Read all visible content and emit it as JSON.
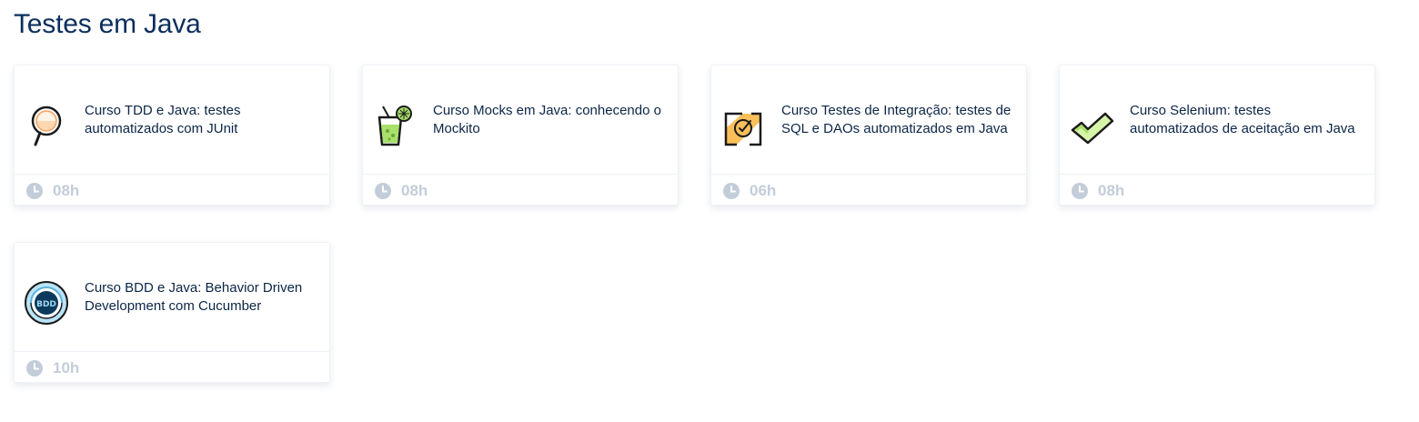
{
  "section": {
    "title": "Testes em Java"
  },
  "courses": [
    {
      "title": "Curso TDD e Java: testes automatizados com JUnit",
      "duration": "08h",
      "icon": "magnifier-icon"
    },
    {
      "title": "Curso Mocks em Java: conhecendo o Mockito",
      "duration": "08h",
      "icon": "drink-glass-icon"
    },
    {
      "title": "Curso Testes de Integração: testes de SQL e DAOs automatizados em Java",
      "duration": "06h",
      "icon": "integration-check-icon"
    },
    {
      "title": "Curso Selenium: testes automatizados de aceitação em Java",
      "duration": "08h",
      "icon": "checkmark-icon"
    },
    {
      "title": "Curso BDD e Java: Behavior Driven Development com Cucumber",
      "duration": "10h",
      "icon": "bdd-cycle-icon",
      "icon_text": "BDD"
    }
  ],
  "colors": {
    "title": "#0b2e5d",
    "card_text": "#0b2547",
    "duration_text": "#c3cdd9",
    "border": "#eef1f5"
  }
}
